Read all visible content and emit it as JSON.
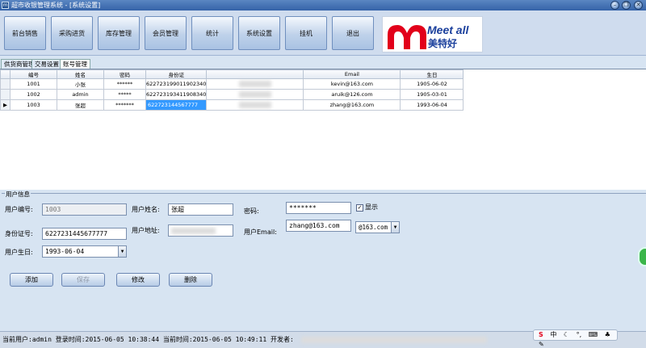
{
  "window": {
    "title": "超市收银管理系统 - [系统设置]",
    "icon_label": "m"
  },
  "toolbar": {
    "buttons": [
      "前台销售",
      "采购进货",
      "库存管理",
      "会员管理",
      "统计",
      "系统设置",
      "挂机",
      "退出"
    ]
  },
  "logo": {
    "text_top": "Meet all",
    "text_bottom": "美特好"
  },
  "tabs": [
    "供货商管理",
    "交易设置",
    "账号管理"
  ],
  "grid": {
    "columns": [
      "编号",
      "姓名",
      "密码",
      "身份证",
      "",
      "Email",
      "生日"
    ],
    "rows": [
      {
        "id": "1001",
        "name": "小张",
        "password": "******",
        "idcard": "622723199011902340",
        "email": "kevin@163.com",
        "birthday": "1905-06-02"
      },
      {
        "id": "1002",
        "name": "admin",
        "password": "*****",
        "idcard": "622723193411908340",
        "email": "aruik@126.com",
        "birthday": "1905-03-01"
      },
      {
        "id": "1003",
        "name": "张超",
        "password": "*******",
        "idcard": "622723144567777",
        "email": "zhang@163.com",
        "birthday": "1993-06-04"
      }
    ]
  },
  "form": {
    "group_title": "用户信息",
    "id_label": "用户编号:",
    "id_value": "1003",
    "name_label": "用户姓名:",
    "name_value": "张超",
    "password_label": "密码:",
    "password_value": "*******",
    "show_label": "显示",
    "idcard_label": "身份证号:",
    "idcard_value": "6227231445677777",
    "address_label": "用户地址:",
    "email_label": "用户Email:",
    "email_value": "zhang@163.com",
    "email_domain": "@163.com",
    "birthday_label": "用户生日:",
    "birthday_value": "1993-06-04"
  },
  "actions": {
    "add": "添加",
    "save": "保存",
    "edit": "修改",
    "delete": "删除"
  },
  "status": {
    "text": "当前用户:admin 登录时间:2015-06-05 10:38:44 当前时间:2015-06-05 10:49:11 开发者:"
  },
  "ime": {
    "lang": "中"
  },
  "colors": {
    "selection": "#3399ff",
    "logo_red": "#e2001a",
    "logo_blue": "#1a3f9c"
  }
}
